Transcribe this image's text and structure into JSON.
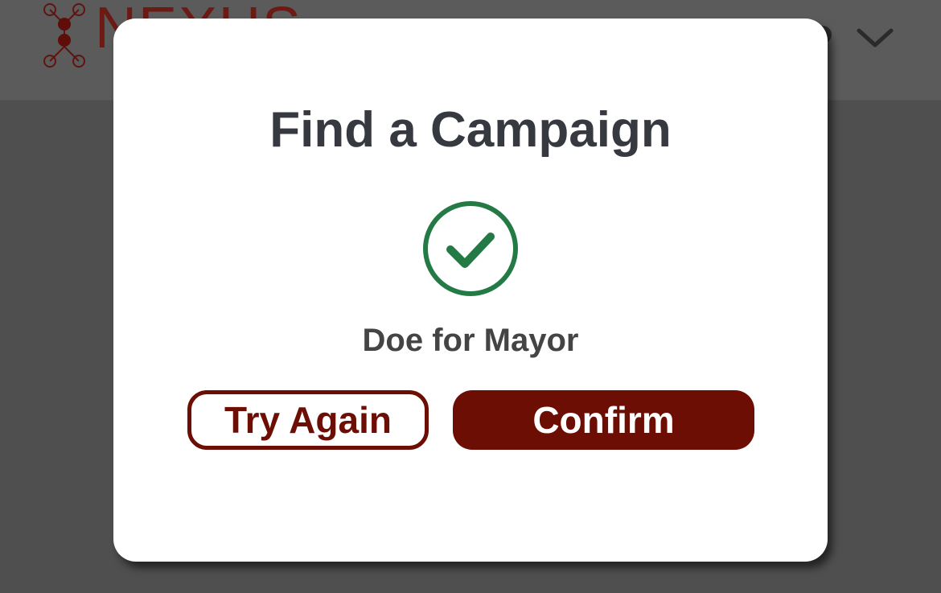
{
  "app": {
    "logo_text": "NEXUS"
  },
  "modal": {
    "title": "Find a Campaign",
    "result_name": "Doe for Mayor",
    "try_again_label": "Try Again",
    "confirm_label": "Confirm"
  },
  "icons": {
    "success": "check-circle-icon",
    "header_menu": "chevron-down-icon"
  },
  "colors": {
    "brand": "#6c0e04",
    "success": "#237a45",
    "overlay": "#4f4f4f",
    "title_text": "#363940"
  }
}
